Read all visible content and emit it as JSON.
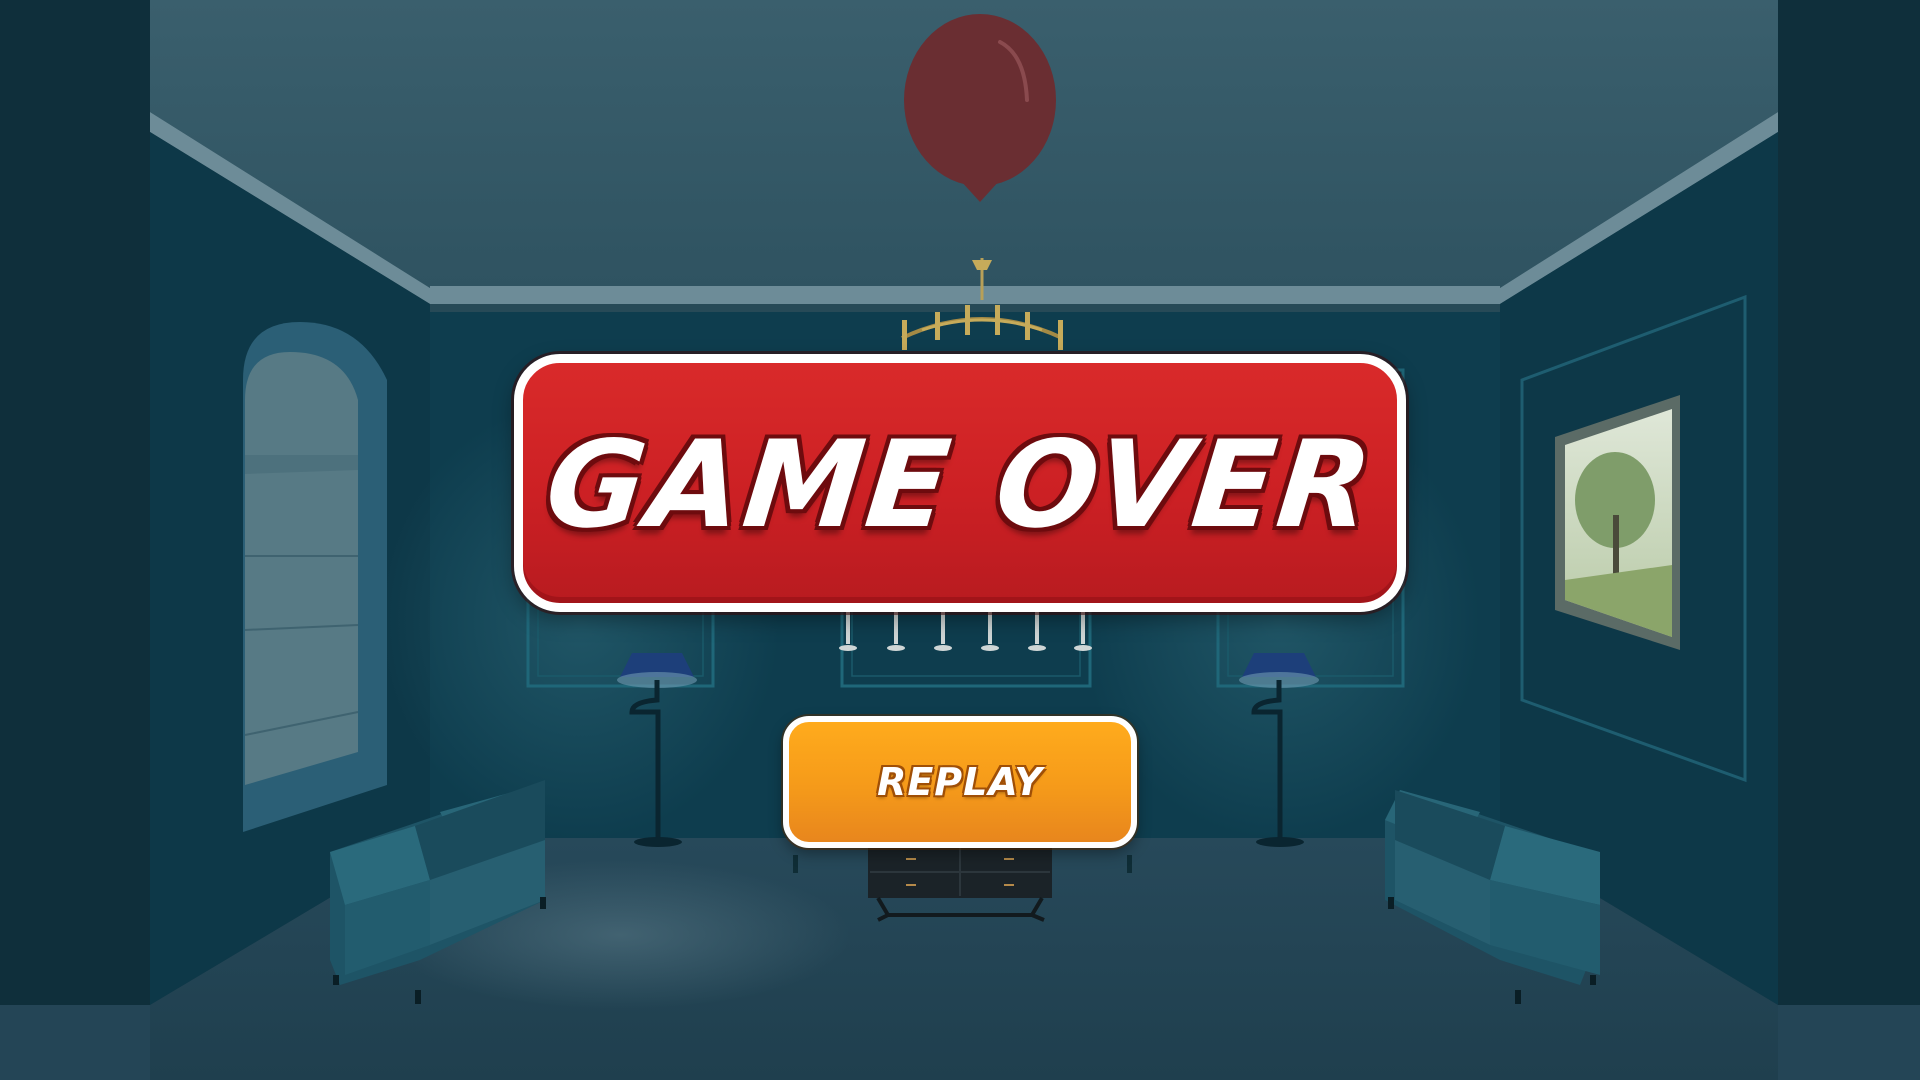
{
  "game_over": {
    "title": "GAME OVER"
  },
  "replay": {
    "label": "REPLAY"
  },
  "colors": {
    "wall": "#0d3a4a",
    "ceiling": "#365a68",
    "floor": "#2a4a5a",
    "banner_red": "#cc2024",
    "button_orange": "#f59a1a",
    "balloon": "#6a2e32"
  },
  "icons": {
    "balloon": "red-balloon-icon",
    "chandelier": "chandelier-icon"
  }
}
